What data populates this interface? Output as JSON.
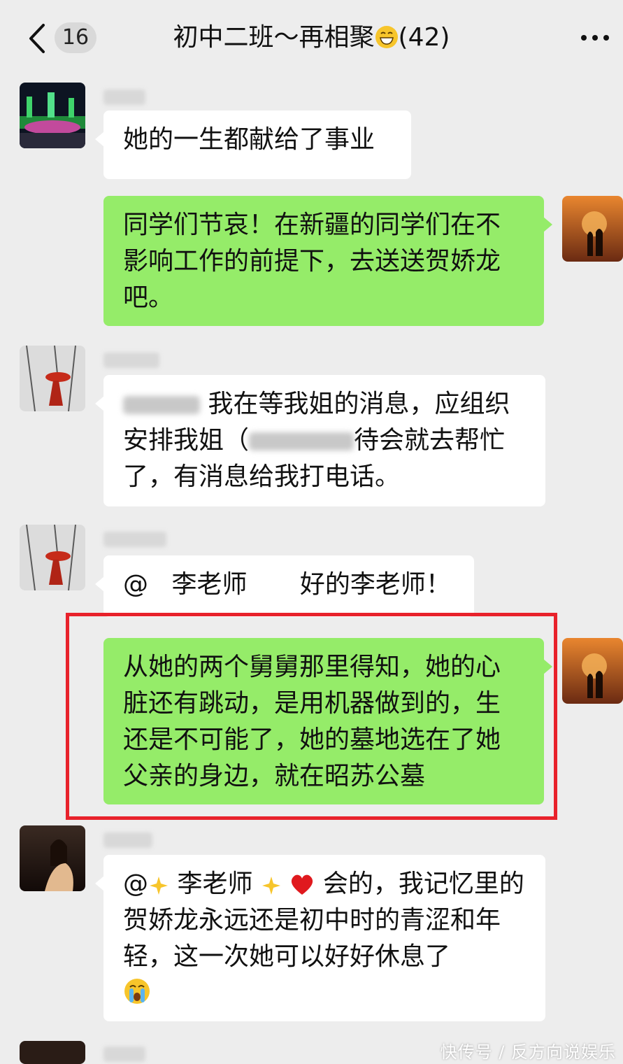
{
  "header": {
    "back_label": "<",
    "unread_count": "16",
    "title": "初中二班～再相聚",
    "member_count": "(42)"
  },
  "messages": [
    {
      "side": "left",
      "text": "她的一生都献给了事业"
    },
    {
      "side": "right",
      "text": "同学们节哀！在新疆的同学们在不影响工作的前提下，去送送贺娇龙吧。"
    },
    {
      "side": "left",
      "lines": [
        "我在等我姐的消息，应组织",
        "安排我姐（",
        "待会就去帮忙",
        "了，有消息给我打电话。"
      ]
    },
    {
      "side": "left",
      "mention": "@",
      "mention_name": "李老师",
      "text": "好的李老师！"
    },
    {
      "side": "right",
      "text": "从她的两个舅舅那里得知，她的心脏还有跳动，是用机器做到的，生还是不可能了，她的墓地选在了她父亲的身边，就在昭苏公墓"
    },
    {
      "side": "left",
      "mention": "@",
      "mention_name": "李老师",
      "text_a": "会的，我记忆",
      "text_b": "里的贺娇龙永远还是初中时的青涩和年轻，这一次她可以好好休息了"
    }
  ],
  "watermark": "快传号 / 反方向说娱乐",
  "colors": {
    "green_bubble": "#95ec69",
    "highlight_border": "#e8222b",
    "background": "#ededed"
  },
  "icons": [
    "back-chevron-icon",
    "grin-emoji-icon",
    "more-dots-icon",
    "sparkle-emoji-icon",
    "heart-emoji-icon",
    "crying-emoji-icon"
  ]
}
